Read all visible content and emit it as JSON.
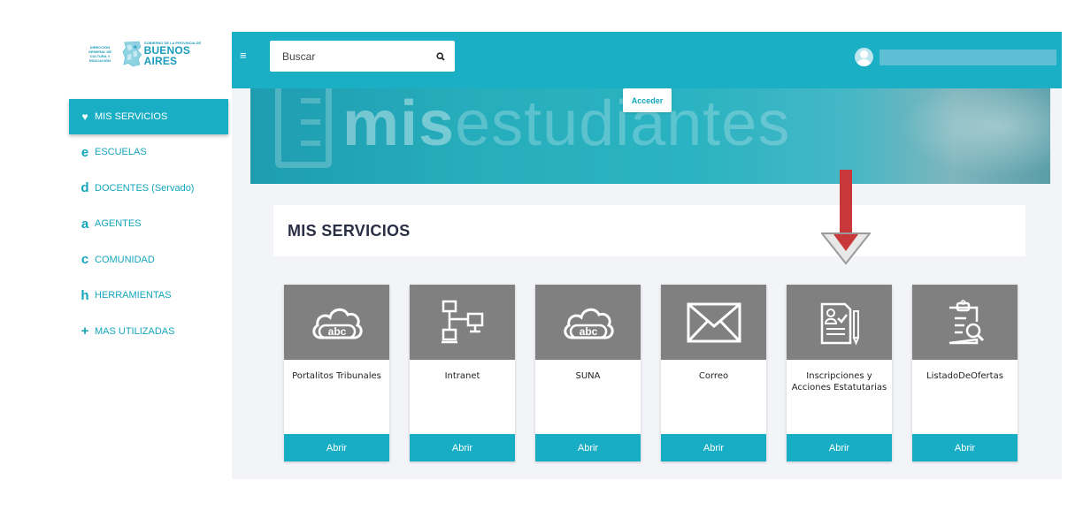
{
  "logo": {
    "left_text": "DIRECCIÓN GENERAL DE CULTURA Y EDUCACIÓN",
    "right_small": "GOBIERNO DE LA PROVINCIA DE",
    "right_big": "BUENOS AIRES"
  },
  "sidebar": {
    "items": [
      {
        "letter": "♥",
        "label": "MIS SERVICIOS",
        "active": true
      },
      {
        "letter": "e",
        "label": "ESCUELAS"
      },
      {
        "letter": "d",
        "label": "DOCENTES (Servado)"
      },
      {
        "letter": "a",
        "label": "AGENTES"
      },
      {
        "letter": "c",
        "label": "COMUNIDAD"
      },
      {
        "letter": "h",
        "label": "HERRAMIENTAS"
      },
      {
        "letter": "+",
        "label": "MAS UTILIZADAS"
      }
    ]
  },
  "topbar": {
    "menu_glyph": "≡",
    "search_placeholder": "Buscar",
    "search_icon": "search-icon"
  },
  "banner": {
    "bold_text": "mis",
    "light_text": "estudiantes",
    "button_label": "Acceder"
  },
  "section": {
    "title": "MIS SERVICIOS"
  },
  "cards": [
    {
      "title": "Portalitos Tribunales",
      "icon": "cloud-abc-icon",
      "button": "Abrir"
    },
    {
      "title": "Intranet",
      "icon": "network-icon",
      "button": "Abrir"
    },
    {
      "title": "SUNA",
      "icon": "cloud-abc-icon",
      "button": "Abrir"
    },
    {
      "title": "Correo",
      "icon": "envelope-icon",
      "button": "Abrir"
    },
    {
      "title": "Inscripciones y Acciones Estatutarias",
      "icon": "document-pen-icon",
      "button": "Abrir"
    },
    {
      "title": "ListadoDeOfertas",
      "icon": "clipboard-search-icon",
      "button": "Abrir"
    }
  ],
  "colors": {
    "accent": "#1aafc5",
    "card_image_bg": "#808080",
    "arrow": "#c8373a"
  }
}
